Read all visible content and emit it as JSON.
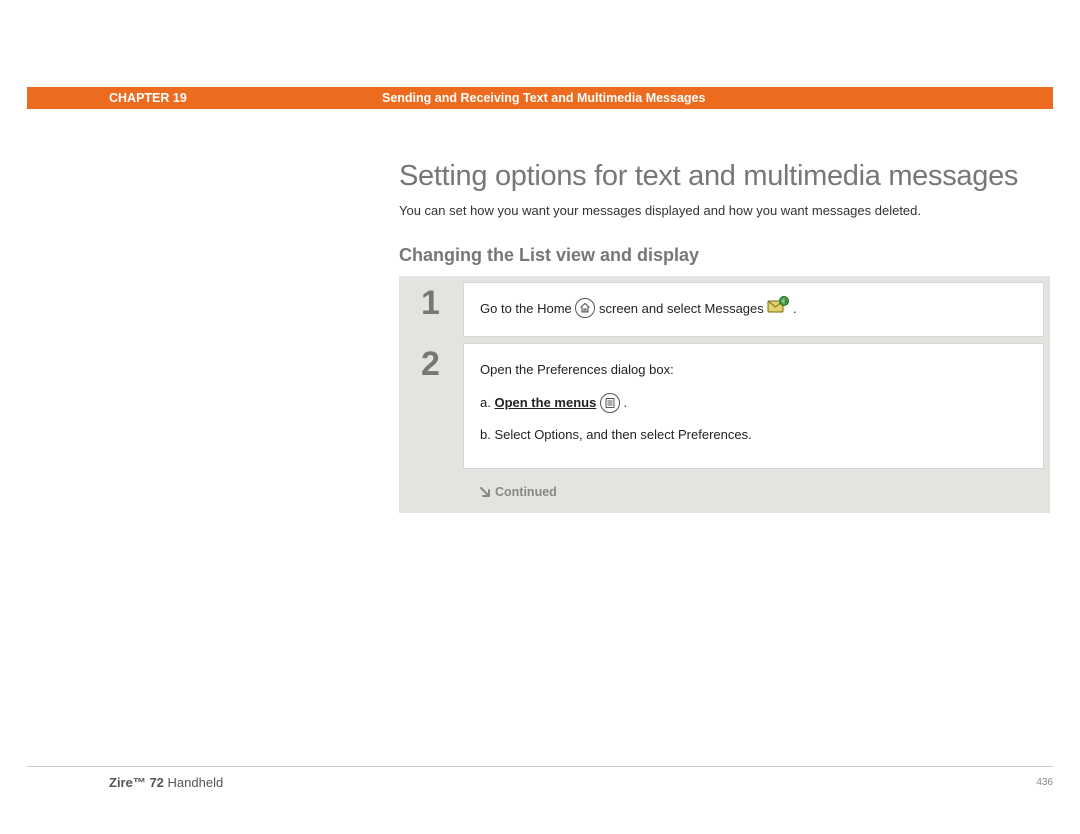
{
  "header": {
    "chapter_label": "CHAPTER 19",
    "chapter_title": "Sending and Receiving Text and Multimedia Messages"
  },
  "main": {
    "title": "Setting options for text and multimedia messages",
    "intro": "You can set how you want your messages displayed and how you want messages deleted.",
    "subsection": "Changing the List view and display",
    "steps": [
      {
        "num": "1",
        "pre": "Go to the Home ",
        "mid": " screen and select Messages ",
        "post": " ."
      },
      {
        "num": "2",
        "line1": "Open the Preferences dialog box:",
        "a_prefix": "a.  ",
        "a_link": "Open the menus",
        "a_post": " .",
        "b": "b.  Select Options, and then select Preferences."
      }
    ],
    "continued": "Continued"
  },
  "footer": {
    "product_bold": "Zire™ 72",
    "product_rest": " Handheld",
    "page": "436"
  }
}
